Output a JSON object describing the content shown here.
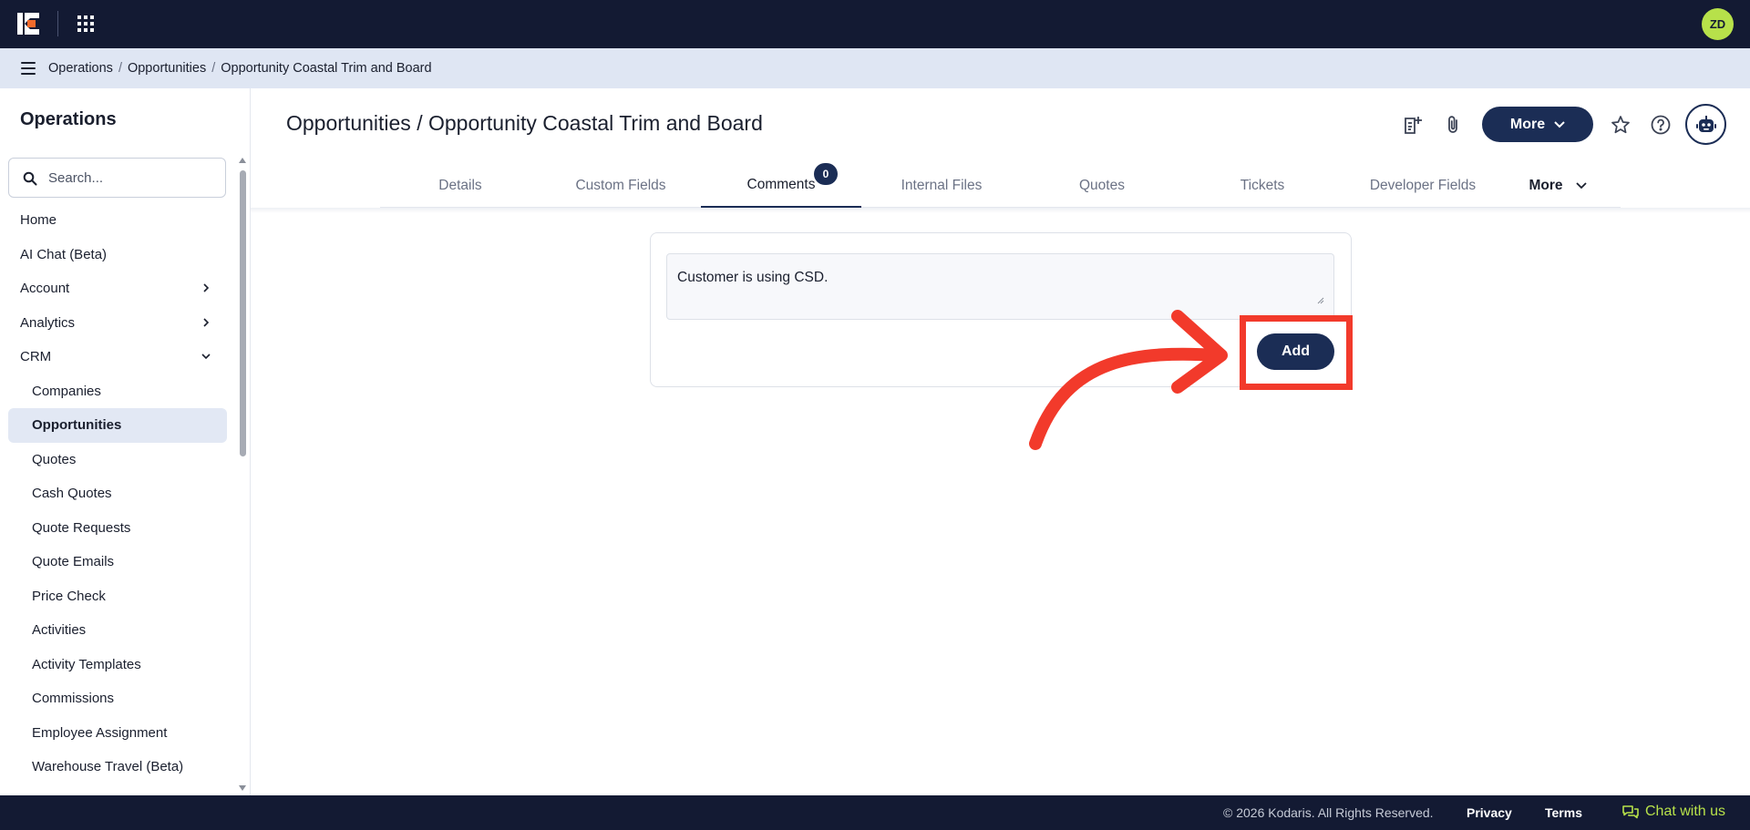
{
  "topbar": {
    "avatar_initials": "ZD"
  },
  "breadcrumb": [
    "Operations",
    "Opportunities",
    "Opportunity Coastal Trim and Board"
  ],
  "sidebar": {
    "title": "Operations",
    "search_placeholder": "Search...",
    "items": [
      {
        "label": "Home"
      },
      {
        "label": "AI Chat (Beta)"
      },
      {
        "label": "Account",
        "chevron": "right"
      },
      {
        "label": "Analytics",
        "chevron": "right"
      },
      {
        "label": "CRM",
        "chevron": "down"
      },
      {
        "label": "Companies"
      },
      {
        "label": "Opportunities"
      },
      {
        "label": "Quotes"
      },
      {
        "label": "Cash Quotes"
      },
      {
        "label": "Quote Requests"
      },
      {
        "label": "Quote Emails"
      },
      {
        "label": "Price Check"
      },
      {
        "label": "Activities"
      },
      {
        "label": "Activity Templates"
      },
      {
        "label": "Commissions"
      },
      {
        "label": "Employee Assignment"
      },
      {
        "label": "Warehouse Travel (Beta)"
      }
    ]
  },
  "main": {
    "title": "Opportunities / Opportunity Coastal Trim and Board",
    "more_label": "More",
    "tabs": [
      {
        "label": "Details"
      },
      {
        "label": "Custom Fields"
      },
      {
        "label": "Comments",
        "active": true
      },
      {
        "label": "Internal Files"
      },
      {
        "label": "Quotes"
      },
      {
        "label": "Tickets"
      },
      {
        "label": "Developer Fields"
      },
      {
        "label": "More"
      }
    ],
    "comments_count": "0",
    "comment_text": "Customer is using CSD.",
    "add_label": "Add"
  },
  "footer": {
    "copyright": "© 2026 Kodaris. All Rights Reserved.",
    "privacy": "Privacy",
    "terms": "Terms",
    "chat": "Chat with us"
  },
  "colors": {
    "navy": "#131a33",
    "button_navy": "#1b2d55",
    "accent_green": "#b7e14a",
    "annotation_red": "#f23a2b"
  }
}
